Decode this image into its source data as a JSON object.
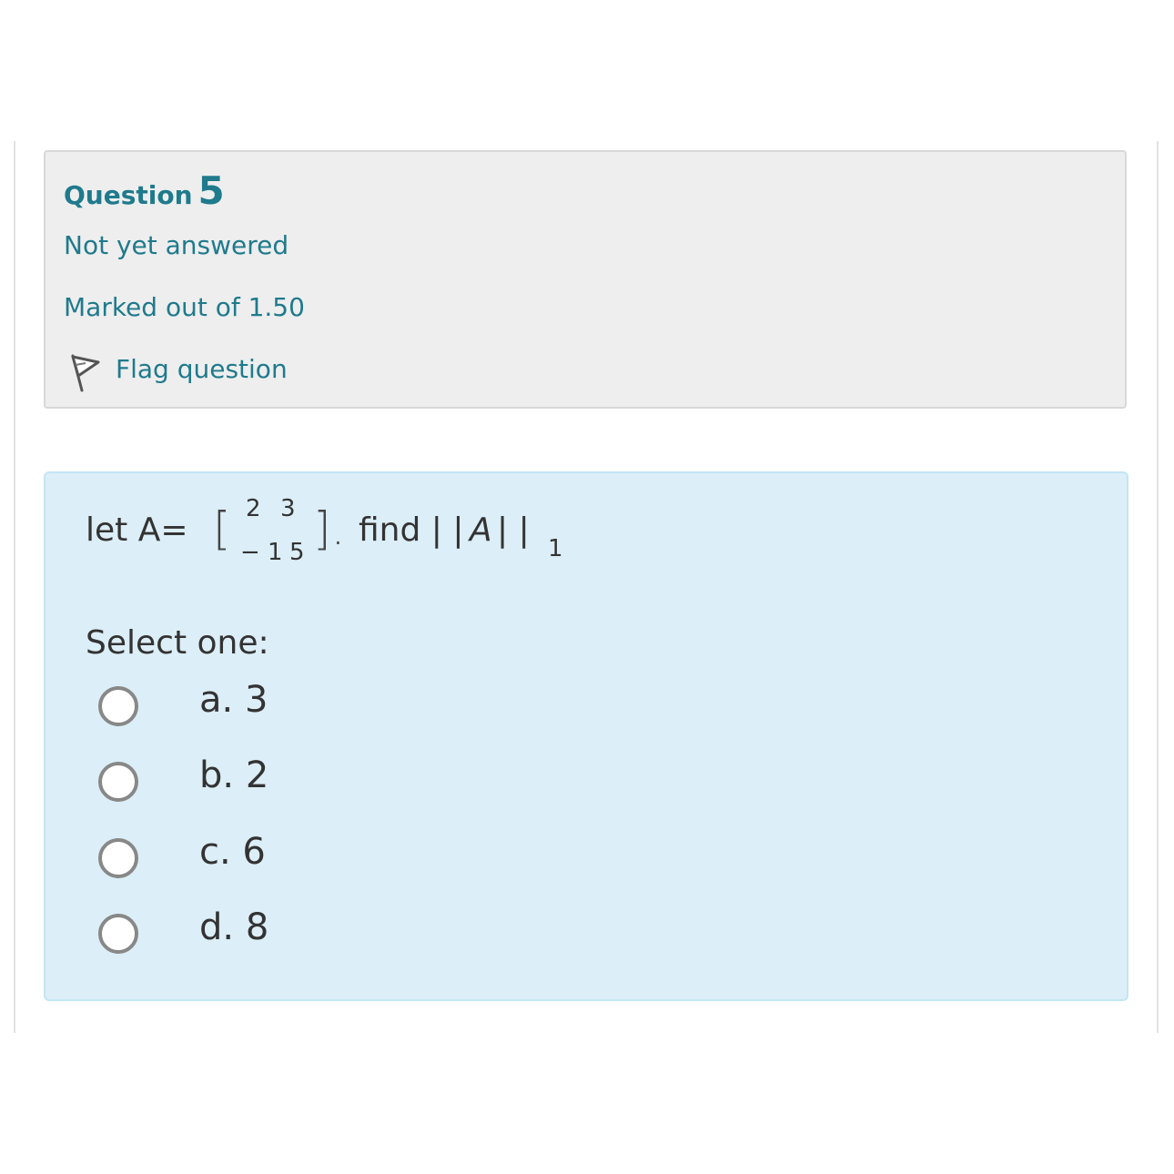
{
  "question": {
    "title_word": "Question",
    "number": "5",
    "state": "Not yet answered",
    "grade": "Marked out of 1.50",
    "flag_label": "Flag question",
    "icons": {
      "flag": "flag-icon"
    },
    "colors": {
      "accent": "#1f7a8c",
      "info_bg": "#eeeeee",
      "content_bg": "#dceef7"
    }
  },
  "content": {
    "qtext": {
      "prefix": "let  A=",
      "bracket_open": "[",
      "matrix": {
        "r1c1": "2",
        "r1c2": "3",
        "r2c1": "− 1",
        "r2c2": "5"
      },
      "bracket_close": "].",
      "find": "find | |",
      "var": "A",
      "bars": "| |",
      "subscript": "1"
    },
    "prompt": "Select one:",
    "options": [
      {
        "label": "a. 3",
        "selected": false
      },
      {
        "label": "b. 2",
        "selected": false
      },
      {
        "label": "c. 6",
        "selected": false
      },
      {
        "label": "d. 8",
        "selected": false
      }
    ]
  }
}
